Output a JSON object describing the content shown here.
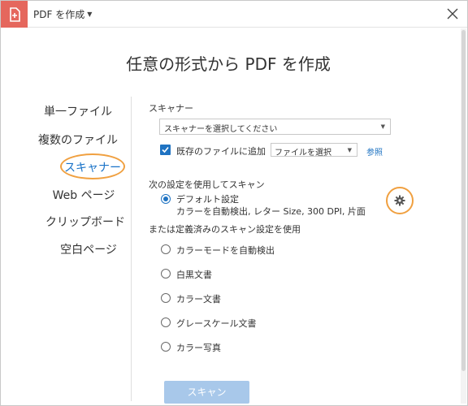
{
  "titlebar": {
    "title": "PDF を作成"
  },
  "heading": "任意の形式から PDF を作成",
  "nav": {
    "items": [
      {
        "label": "単一ファイル"
      },
      {
        "label": "複数のファイル"
      },
      {
        "label": "スキャナー"
      },
      {
        "label": "Web ページ"
      },
      {
        "label": "クリップボード"
      },
      {
        "label": "空白ページ"
      }
    ]
  },
  "scanner": {
    "section_label": "スキャナー",
    "scanner_select": "スキャナーを選択してください",
    "append_label": "既存のファイルに追加",
    "file_select": "ファイルを選択",
    "browse_link": "参照",
    "settings_label": "次の設定を使用してスキャン",
    "default_title": "デフォルト設定",
    "default_desc": "カラーを自動検出, レター Size, 300 DPI, 片面",
    "or_label": "または定義済みのスキャン設定を使用",
    "presets": [
      {
        "label": "カラーモードを自動検出"
      },
      {
        "label": "白黒文書"
      },
      {
        "label": "カラー文書"
      },
      {
        "label": "グレースケール文書"
      },
      {
        "label": "カラー写真"
      }
    ],
    "scan_button": "スキャン"
  },
  "colors": {
    "app_icon": "#e5675d",
    "accent": "#1f73c2",
    "highlight_ring": "#f0a040",
    "disabled_button": "#a8c8ea"
  },
  "icons": {
    "app": "pdf-create-icon",
    "close": "close-icon",
    "settings": "gear-icon"
  }
}
